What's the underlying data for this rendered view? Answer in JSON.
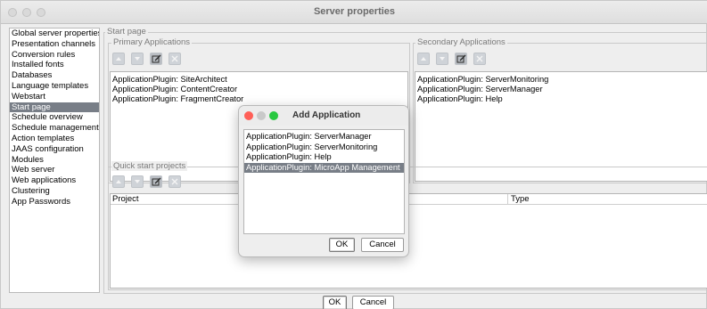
{
  "window": {
    "title": "Server properties",
    "traffic_lights": [
      "close-button",
      "minimize-button",
      "zoom-button"
    ]
  },
  "nav": {
    "selected_index": 8,
    "items": [
      "Global server properties",
      "Presentation channels",
      "Conversion rules",
      "Installed fonts",
      "Databases",
      "Language templates",
      "Webstart",
      "Start page",
      "Schedule overview",
      "Schedule management",
      "Action templates",
      "JAAS configuration",
      "Modules",
      "Web server",
      "Web applications",
      "Clustering",
      "App Passwords"
    ]
  },
  "start_page": {
    "label": "Start page",
    "primary": {
      "label": "Primary Applications",
      "items": [
        "ApplicationPlugin: SiteArchitect",
        "ApplicationPlugin: ContentCreator",
        "ApplicationPlugin: FragmentCreator"
      ]
    },
    "secondary": {
      "label": "Secondary Applications",
      "items": [
        "ApplicationPlugin: ServerMonitoring",
        "ApplicationPlugin: ServerManager",
        "ApplicationPlugin: Help"
      ]
    },
    "quick_start": {
      "label": "Quick start projects",
      "columns": [
        "Project",
        "Type"
      ]
    }
  },
  "toolbar_icons": [
    "move-up-icon",
    "move-down-icon",
    "edit-icon",
    "remove-icon"
  ],
  "footer": {
    "ok_label": "OK",
    "cancel_label": "Cancel"
  },
  "dialog": {
    "title": "Add Application",
    "selected_index": 3,
    "items": [
      "ApplicationPlugin: ServerManager",
      "ApplicationPlugin: ServerMonitoring",
      "ApplicationPlugin: Help",
      "ApplicationPlugin: MicroApp Management"
    ],
    "ok_label": "OK",
    "cancel_label": "Cancel",
    "colors": {
      "close": "#ff5f57",
      "minimize": "#febc2e",
      "zoom": "#28c840"
    }
  },
  "colors": {
    "selection": "#787e87",
    "window_bg": "#eeeeee",
    "toolbar_button": "#cfd3d8"
  }
}
